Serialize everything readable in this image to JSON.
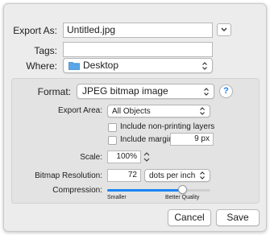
{
  "export_as": {
    "label": "Export As:",
    "value": "Untitled.jpg",
    "expand_icon": "chevron-down-icon"
  },
  "tags": {
    "label": "Tags:",
    "value": ""
  },
  "where": {
    "label": "Where:",
    "value": "Desktop",
    "icon": "folder-icon"
  },
  "format": {
    "label": "Format:",
    "value": "JPEG bitmap image",
    "help_label": "?"
  },
  "export_area": {
    "label": "Export Area:",
    "value": "All Objects"
  },
  "options": {
    "include_non_printing": {
      "label": "Include non-printing layers",
      "checked": false
    },
    "include_margin": {
      "label": "Include margin:",
      "checked": false,
      "value": "9 px"
    }
  },
  "scale": {
    "label": "Scale:",
    "value": "100%"
  },
  "bitmap_resolution": {
    "label": "Bitmap Resolution:",
    "value": "72",
    "unit": "dots per inch"
  },
  "compression": {
    "label": "Compression:",
    "min_label": "Smaller",
    "max_label": "Better Quality",
    "level": 0.75
  },
  "buttons": {
    "cancel": "Cancel",
    "save": "Save"
  },
  "colors": {
    "accent": "#1a84f2",
    "dialog_bg": "#ececec",
    "panel_bg": "#e3e3e3"
  }
}
